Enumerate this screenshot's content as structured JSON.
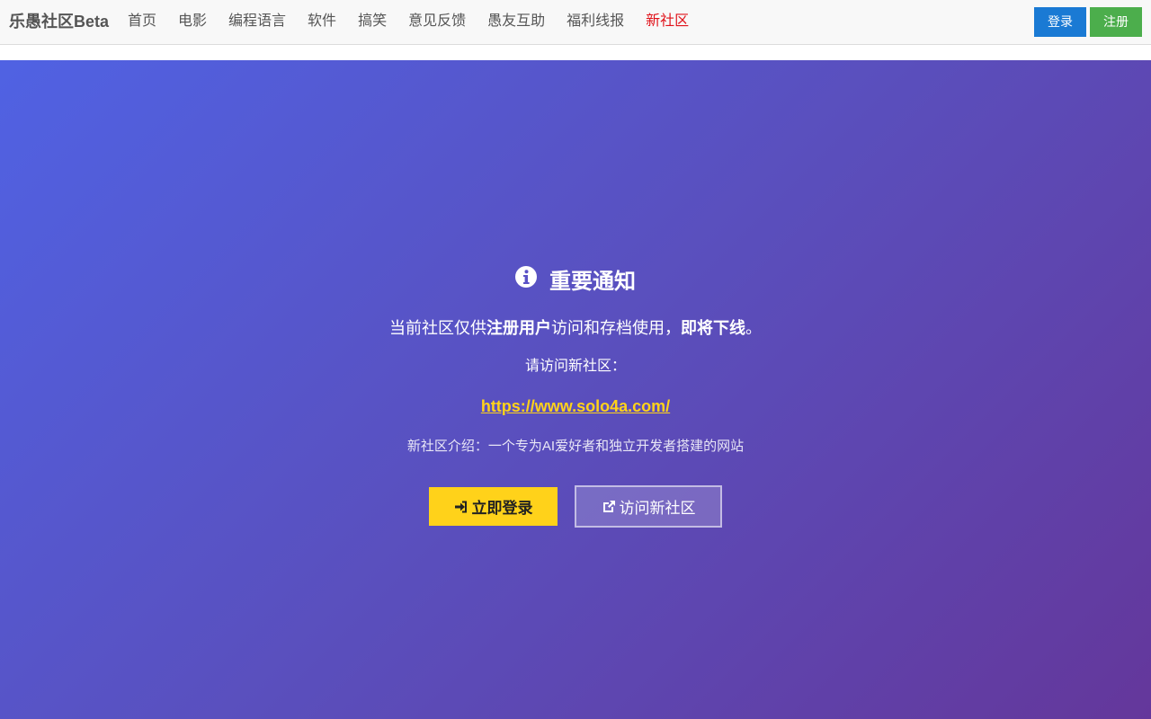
{
  "navbar": {
    "brand": "乐愚社区Beta",
    "links": [
      {
        "label": "首页"
      },
      {
        "label": "电影"
      },
      {
        "label": "编程语言"
      },
      {
        "label": "软件"
      },
      {
        "label": "搞笑"
      },
      {
        "label": "意见反馈"
      },
      {
        "label": "愚友互助"
      },
      {
        "label": "福利线报"
      },
      {
        "label": "新社区",
        "highlight": true
      }
    ],
    "login_label": "登录",
    "register_label": "注册"
  },
  "notice": {
    "title": "重要通知",
    "line1": {
      "part1": "当前社区仅供",
      "part2_bold": "注册用户",
      "part3": "访问和存档使用，",
      "part4_bold": "即将下线",
      "part5": "。"
    },
    "line2": "请访问新社区：",
    "url": "https://www.solo4a.com/",
    "intro": "新社区介绍：一个专为AI爱好者和独立开发者搭建的网站",
    "primary_button": "立即登录",
    "secondary_button": "访问新社区"
  },
  "colors": {
    "nav_bg": "#f8f8f8",
    "login_btn": "#1a7ad4",
    "register_btn": "#4cae4c",
    "highlight_link": "#e0121a",
    "gradient_start": "#5062e3",
    "gradient_end": "#64379b",
    "accent_yellow": "#ffd21a"
  },
  "icons": {
    "notice": "info-circle-icon",
    "login": "sign-in-icon",
    "external": "external-link-icon"
  }
}
